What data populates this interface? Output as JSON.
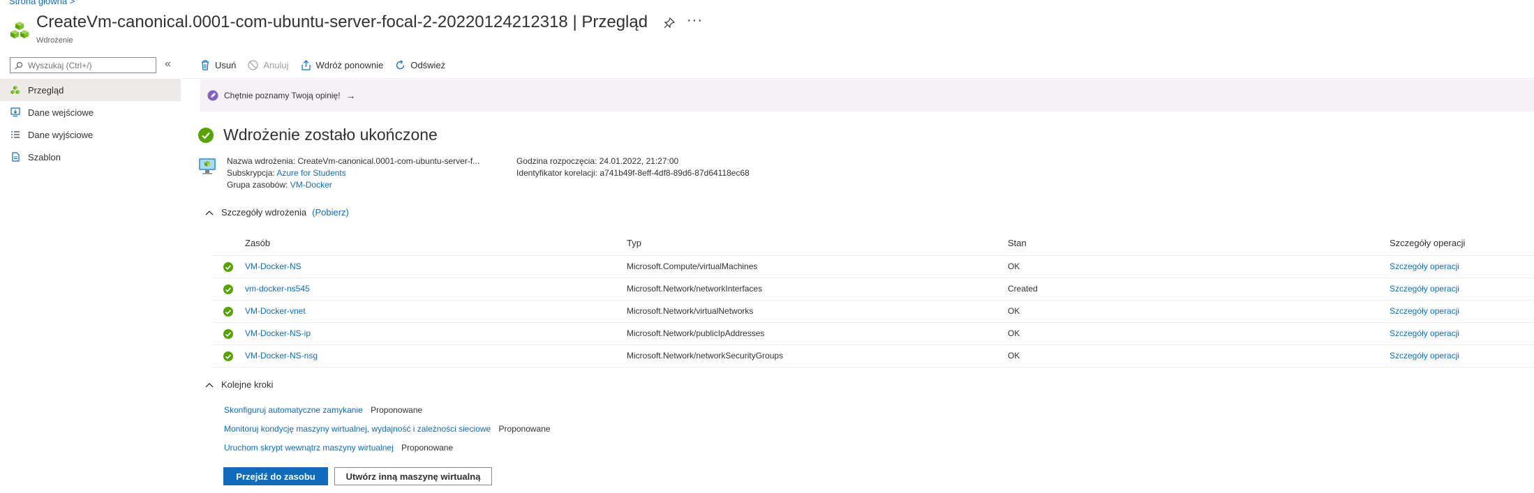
{
  "breadcrumb": {
    "home": "Strona główna",
    "sep": ">"
  },
  "header": {
    "title": "CreateVm-canonical.0001-com-ubuntu-server-focal-2-20220124212318",
    "separator": "|",
    "section": "Przegląd",
    "subtitle": "Wdrożenie",
    "more": "···"
  },
  "sidebar": {
    "search_placeholder": "Wyszukaj (Ctrl+/)",
    "collapse": "«",
    "items": [
      {
        "label": "Przegląd",
        "icon": "deployment-icon",
        "active": true
      },
      {
        "label": "Dane wejściowe",
        "icon": "inputs-icon"
      },
      {
        "label": "Dane wyjściowe",
        "icon": "outputs-icon"
      },
      {
        "label": "Szablon",
        "icon": "template-icon"
      }
    ]
  },
  "toolbar": {
    "delete": "Usuń",
    "cancel": "Anuluj",
    "redeploy": "Wdróż ponownie",
    "refresh": "Odśwież"
  },
  "banner": {
    "text": "Chętnie poznamy Twoją opinię!",
    "arrow": "→"
  },
  "status": {
    "title": "Wdrożenie zostało ukończone"
  },
  "details": {
    "name_label": "Nazwa wdrożenia:",
    "name_value": "CreateVm-canonical.0001-com-ubuntu-server-f...",
    "subscription_label": "Subskrypcja:",
    "subscription_value": "Azure for Students",
    "group_label": "Grupa zasobów:",
    "group_value": "VM-Docker",
    "start_label": "Godzina rozpoczęcia:",
    "start_value": "24.01.2022, 21:27:00",
    "correlation_label": "Identyfikator korelacji:",
    "correlation_value": "a741b49f-8eff-4df8-89d6-87d64118ec68"
  },
  "deployment_details": {
    "title": "Szczegóły wdrożenia",
    "download": "(Pobierz)",
    "columns": [
      "Zasób",
      "Typ",
      "Stan",
      "Szczegóły operacji"
    ],
    "rows": [
      {
        "resource": "VM-Docker-NS",
        "type": "Microsoft.Compute/virtualMachines",
        "status": "OK",
        "details": "Szczegóły operacji"
      },
      {
        "resource": "vm-docker-ns545",
        "type": "Microsoft.Network/networkInterfaces",
        "status": "Created",
        "details": "Szczegóły operacji"
      },
      {
        "resource": "VM-Docker-vnet",
        "type": "Microsoft.Network/virtualNetworks",
        "status": "OK",
        "details": "Szczegóły operacji"
      },
      {
        "resource": "VM-Docker-NS-ip",
        "type": "Microsoft.Network/publicIpAddresses",
        "status": "OK",
        "details": "Szczegóły operacji"
      },
      {
        "resource": "VM-Docker-NS-nsg",
        "type": "Microsoft.Network/networkSecurityGroups",
        "status": "OK",
        "details": "Szczegóły operacji"
      }
    ]
  },
  "next_steps": {
    "title": "Kolejne kroki",
    "items": [
      {
        "link": "Skonfiguruj automatyczne zamykanie",
        "tag": "Proponowane"
      },
      {
        "link": "Monitoruj kondycję maszyny wirtualnej, wydajność i zależności sieciowe",
        "tag": "Proponowane"
      },
      {
        "link": "Uruchom skrypt wewnątrz maszyny wirtualnej",
        "tag": "Proponowane"
      }
    ]
  },
  "actions": {
    "primary": "Przejdź do zasobu",
    "secondary": "Utwórz inną maszynę wirtualną"
  },
  "colors": {
    "accent": "#0f6cbd",
    "success": "#57a300",
    "banner_bg": "#f6f1f7"
  }
}
